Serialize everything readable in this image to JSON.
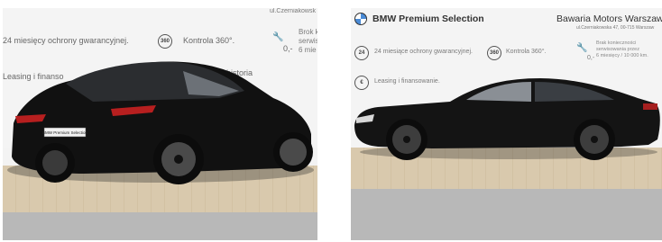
{
  "left_photo": {
    "address_corner": "ul.Czerniakowsk",
    "warranty_text": "miesięcy ochrony gwarancyjnej.",
    "warranty_num": "24",
    "control_badge": "360",
    "control_text": "Kontrola 360°.",
    "damage_text_1": "Brok k",
    "damage_text_2": "serwis",
    "damage_text_3": "6 mie",
    "damage_price": "0,-",
    "leasing_text": "Leasing i finanso",
    "history_text": "historia",
    "plate_text": "BMW Premium Selection"
  },
  "right_photo": {
    "brand_title": "BMW Premium Selection",
    "dealer_name": "Bawaria Motors Warszaw",
    "dealer_address": "ul.Czerniakowska 47, 00-715 Warszaw",
    "warranty_badge": "24",
    "warranty_text": "24 miesiące ochrony gwarancyjnej.",
    "control_badge": "360",
    "control_text": "Kontrola 360°.",
    "damage_price": "0,-",
    "damage_line_1": "Brak konieczności",
    "damage_line_2": "serwisowania przez",
    "damage_line_3": "6 miesięcy / 10 000 km.",
    "leasing_badge": "€",
    "leasing_text": "Leasing i finansowanie."
  }
}
